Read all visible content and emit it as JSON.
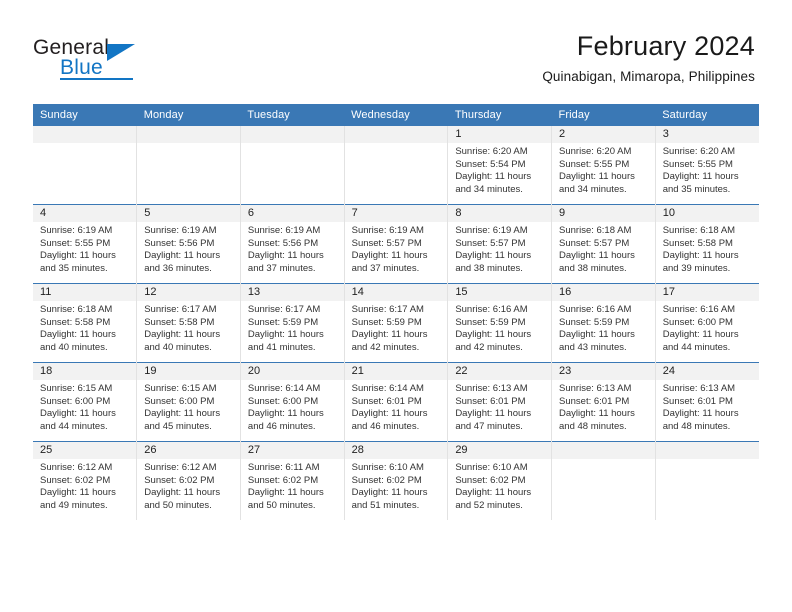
{
  "brand": {
    "name_top": "General",
    "name_bottom": "Blue",
    "accent_color": "#1275c4",
    "text_color": "#231f20"
  },
  "header": {
    "title": "February 2024",
    "subtitle": "Quinabigan, Mimaropa, Philippines"
  },
  "theme": {
    "header_bg": "#3a78b5",
    "daynum_bg": "#f2f2f2",
    "row_rule": "#3a78b5",
    "col_rule": "#e2e2e2"
  },
  "weekday_headers": [
    "Sunday",
    "Monday",
    "Tuesday",
    "Wednesday",
    "Thursday",
    "Friday",
    "Saturday"
  ],
  "weeks": [
    [
      {
        "day": "",
        "sunrise": "",
        "sunset": "",
        "daylight_line1": "",
        "daylight_line2": ""
      },
      {
        "day": "",
        "sunrise": "",
        "sunset": "",
        "daylight_line1": "",
        "daylight_line2": ""
      },
      {
        "day": "",
        "sunrise": "",
        "sunset": "",
        "daylight_line1": "",
        "daylight_line2": ""
      },
      {
        "day": "",
        "sunrise": "",
        "sunset": "",
        "daylight_line1": "",
        "daylight_line2": ""
      },
      {
        "day": "1",
        "sunrise": "Sunrise: 6:20 AM",
        "sunset": "Sunset: 5:54 PM",
        "daylight_line1": "Daylight: 11 hours",
        "daylight_line2": "and 34 minutes."
      },
      {
        "day": "2",
        "sunrise": "Sunrise: 6:20 AM",
        "sunset": "Sunset: 5:55 PM",
        "daylight_line1": "Daylight: 11 hours",
        "daylight_line2": "and 34 minutes."
      },
      {
        "day": "3",
        "sunrise": "Sunrise: 6:20 AM",
        "sunset": "Sunset: 5:55 PM",
        "daylight_line1": "Daylight: 11 hours",
        "daylight_line2": "and 35 minutes."
      }
    ],
    [
      {
        "day": "4",
        "sunrise": "Sunrise: 6:19 AM",
        "sunset": "Sunset: 5:55 PM",
        "daylight_line1": "Daylight: 11 hours",
        "daylight_line2": "and 35 minutes."
      },
      {
        "day": "5",
        "sunrise": "Sunrise: 6:19 AM",
        "sunset": "Sunset: 5:56 PM",
        "daylight_line1": "Daylight: 11 hours",
        "daylight_line2": "and 36 minutes."
      },
      {
        "day": "6",
        "sunrise": "Sunrise: 6:19 AM",
        "sunset": "Sunset: 5:56 PM",
        "daylight_line1": "Daylight: 11 hours",
        "daylight_line2": "and 37 minutes."
      },
      {
        "day": "7",
        "sunrise": "Sunrise: 6:19 AM",
        "sunset": "Sunset: 5:57 PM",
        "daylight_line1": "Daylight: 11 hours",
        "daylight_line2": "and 37 minutes."
      },
      {
        "day": "8",
        "sunrise": "Sunrise: 6:19 AM",
        "sunset": "Sunset: 5:57 PM",
        "daylight_line1": "Daylight: 11 hours",
        "daylight_line2": "and 38 minutes."
      },
      {
        "day": "9",
        "sunrise": "Sunrise: 6:18 AM",
        "sunset": "Sunset: 5:57 PM",
        "daylight_line1": "Daylight: 11 hours",
        "daylight_line2": "and 38 minutes."
      },
      {
        "day": "10",
        "sunrise": "Sunrise: 6:18 AM",
        "sunset": "Sunset: 5:58 PM",
        "daylight_line1": "Daylight: 11 hours",
        "daylight_line2": "and 39 minutes."
      }
    ],
    [
      {
        "day": "11",
        "sunrise": "Sunrise: 6:18 AM",
        "sunset": "Sunset: 5:58 PM",
        "daylight_line1": "Daylight: 11 hours",
        "daylight_line2": "and 40 minutes."
      },
      {
        "day": "12",
        "sunrise": "Sunrise: 6:17 AM",
        "sunset": "Sunset: 5:58 PM",
        "daylight_line1": "Daylight: 11 hours",
        "daylight_line2": "and 40 minutes."
      },
      {
        "day": "13",
        "sunrise": "Sunrise: 6:17 AM",
        "sunset": "Sunset: 5:59 PM",
        "daylight_line1": "Daylight: 11 hours",
        "daylight_line2": "and 41 minutes."
      },
      {
        "day": "14",
        "sunrise": "Sunrise: 6:17 AM",
        "sunset": "Sunset: 5:59 PM",
        "daylight_line1": "Daylight: 11 hours",
        "daylight_line2": "and 42 minutes."
      },
      {
        "day": "15",
        "sunrise": "Sunrise: 6:16 AM",
        "sunset": "Sunset: 5:59 PM",
        "daylight_line1": "Daylight: 11 hours",
        "daylight_line2": "and 42 minutes."
      },
      {
        "day": "16",
        "sunrise": "Sunrise: 6:16 AM",
        "sunset": "Sunset: 5:59 PM",
        "daylight_line1": "Daylight: 11 hours",
        "daylight_line2": "and 43 minutes."
      },
      {
        "day": "17",
        "sunrise": "Sunrise: 6:16 AM",
        "sunset": "Sunset: 6:00 PM",
        "daylight_line1": "Daylight: 11 hours",
        "daylight_line2": "and 44 minutes."
      }
    ],
    [
      {
        "day": "18",
        "sunrise": "Sunrise: 6:15 AM",
        "sunset": "Sunset: 6:00 PM",
        "daylight_line1": "Daylight: 11 hours",
        "daylight_line2": "and 44 minutes."
      },
      {
        "day": "19",
        "sunrise": "Sunrise: 6:15 AM",
        "sunset": "Sunset: 6:00 PM",
        "daylight_line1": "Daylight: 11 hours",
        "daylight_line2": "and 45 minutes."
      },
      {
        "day": "20",
        "sunrise": "Sunrise: 6:14 AM",
        "sunset": "Sunset: 6:00 PM",
        "daylight_line1": "Daylight: 11 hours",
        "daylight_line2": "and 46 minutes."
      },
      {
        "day": "21",
        "sunrise": "Sunrise: 6:14 AM",
        "sunset": "Sunset: 6:01 PM",
        "daylight_line1": "Daylight: 11 hours",
        "daylight_line2": "and 46 minutes."
      },
      {
        "day": "22",
        "sunrise": "Sunrise: 6:13 AM",
        "sunset": "Sunset: 6:01 PM",
        "daylight_line1": "Daylight: 11 hours",
        "daylight_line2": "and 47 minutes."
      },
      {
        "day": "23",
        "sunrise": "Sunrise: 6:13 AM",
        "sunset": "Sunset: 6:01 PM",
        "daylight_line1": "Daylight: 11 hours",
        "daylight_line2": "and 48 minutes."
      },
      {
        "day": "24",
        "sunrise": "Sunrise: 6:13 AM",
        "sunset": "Sunset: 6:01 PM",
        "daylight_line1": "Daylight: 11 hours",
        "daylight_line2": "and 48 minutes."
      }
    ],
    [
      {
        "day": "25",
        "sunrise": "Sunrise: 6:12 AM",
        "sunset": "Sunset: 6:02 PM",
        "daylight_line1": "Daylight: 11 hours",
        "daylight_line2": "and 49 minutes."
      },
      {
        "day": "26",
        "sunrise": "Sunrise: 6:12 AM",
        "sunset": "Sunset: 6:02 PM",
        "daylight_line1": "Daylight: 11 hours",
        "daylight_line2": "and 50 minutes."
      },
      {
        "day": "27",
        "sunrise": "Sunrise: 6:11 AM",
        "sunset": "Sunset: 6:02 PM",
        "daylight_line1": "Daylight: 11 hours",
        "daylight_line2": "and 50 minutes."
      },
      {
        "day": "28",
        "sunrise": "Sunrise: 6:10 AM",
        "sunset": "Sunset: 6:02 PM",
        "daylight_line1": "Daylight: 11 hours",
        "daylight_line2": "and 51 minutes."
      },
      {
        "day": "29",
        "sunrise": "Sunrise: 6:10 AM",
        "sunset": "Sunset: 6:02 PM",
        "daylight_line1": "Daylight: 11 hours",
        "daylight_line2": "and 52 minutes."
      },
      {
        "day": "",
        "sunrise": "",
        "sunset": "",
        "daylight_line1": "",
        "daylight_line2": ""
      },
      {
        "day": "",
        "sunrise": "",
        "sunset": "",
        "daylight_line1": "",
        "daylight_line2": ""
      }
    ]
  ]
}
